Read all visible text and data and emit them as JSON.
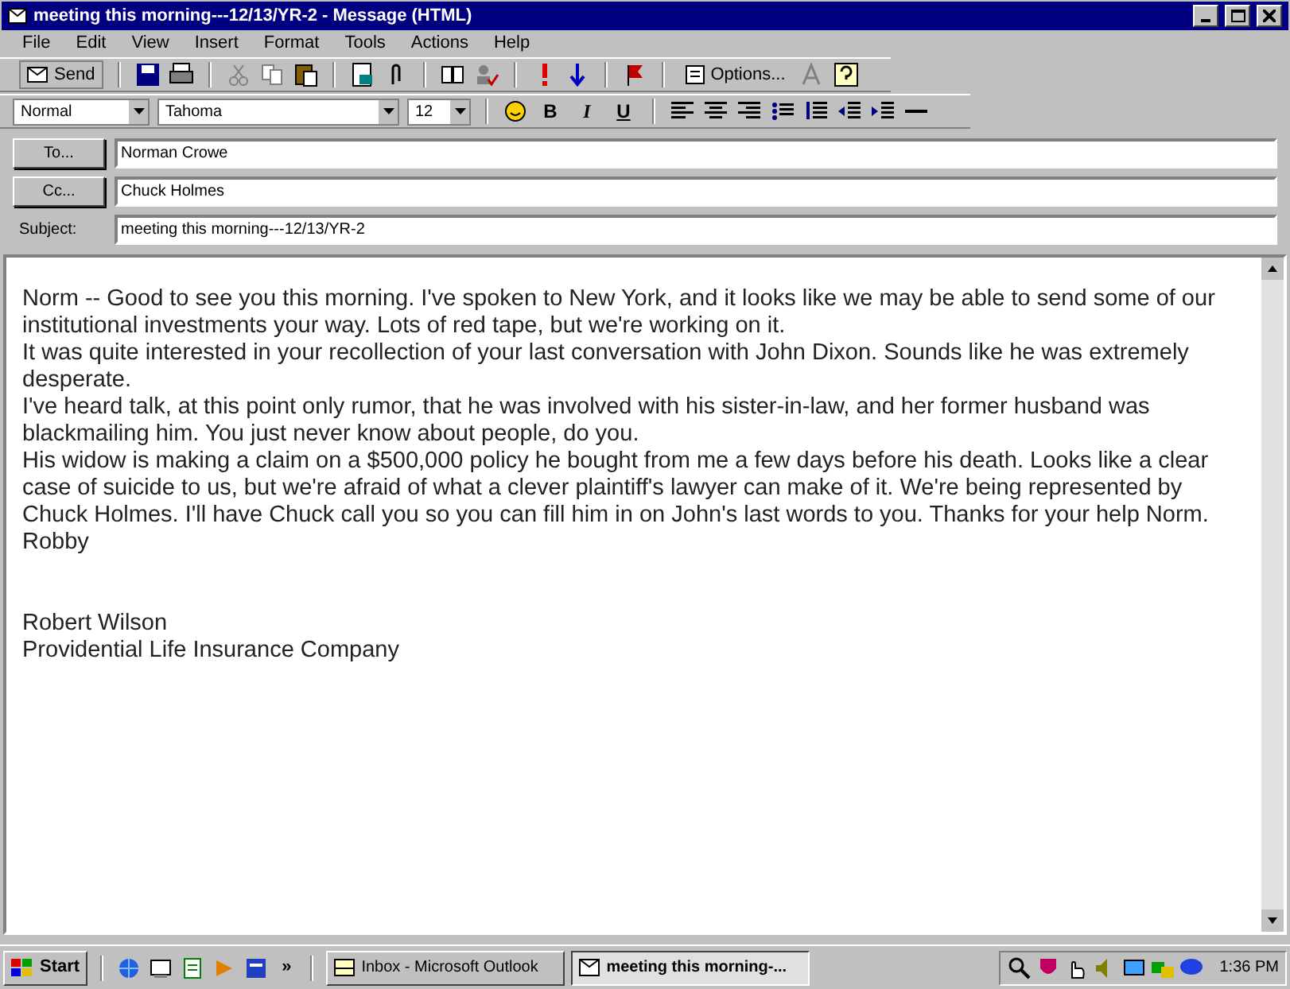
{
  "window": {
    "title": "meeting this morning---12/13/YR-2 - Message (HTML)"
  },
  "menu": [
    "File",
    "Edit",
    "View",
    "Insert",
    "Format",
    "Tools",
    "Actions",
    "Help"
  ],
  "toolbar": {
    "send": "Send",
    "options": "Options..."
  },
  "format_bar": {
    "style": "Normal",
    "font": "Tahoma",
    "size": "12",
    "bold": "B",
    "italic": "I",
    "underline": "U"
  },
  "header": {
    "to_button": "To...",
    "to": "Norman Crowe",
    "cc_button": "Cc...",
    "cc": "Chuck Holmes",
    "subject_label": "Subject:",
    "subject": "meeting this morning---12/13/YR-2"
  },
  "body": [
    "Norm -- Good to see you this morning.  I've spoken to New York, and it looks like we may  be able to send some of our institutional investments your way.  Lots of red tape, but we're working on it.",
    "It was quite interested in your recollection of your last conversation with John Dixon.  Sounds like he was extremely desperate.",
    "I've heard talk, at this point only rumor, that he was involved with his sister-in-law, and her former husband was blackmailing him.  You just never know about people, do you.",
    "His widow is making a claim on a $500,000 policy he bought from me a few days before his death.  Looks like a clear case of suicide to us, but we're afraid of what a clever plaintiff's lawyer can make of it.  We're being represented by Chuck Holmes.  I'll have Chuck call you so you can fill him in on John's last words to you.  Thanks for your help Norm.  Robby"
  ],
  "signature": [
    "Robert Wilson",
    "Providential Life Insurance Company"
  ],
  "taskbar": {
    "start": "Start",
    "more": "»",
    "tasks": [
      {
        "label": "Inbox - Microsoft Outlook",
        "selected": false
      },
      {
        "label": "meeting this morning-...",
        "selected": true
      }
    ],
    "clock": "1:36 PM"
  }
}
